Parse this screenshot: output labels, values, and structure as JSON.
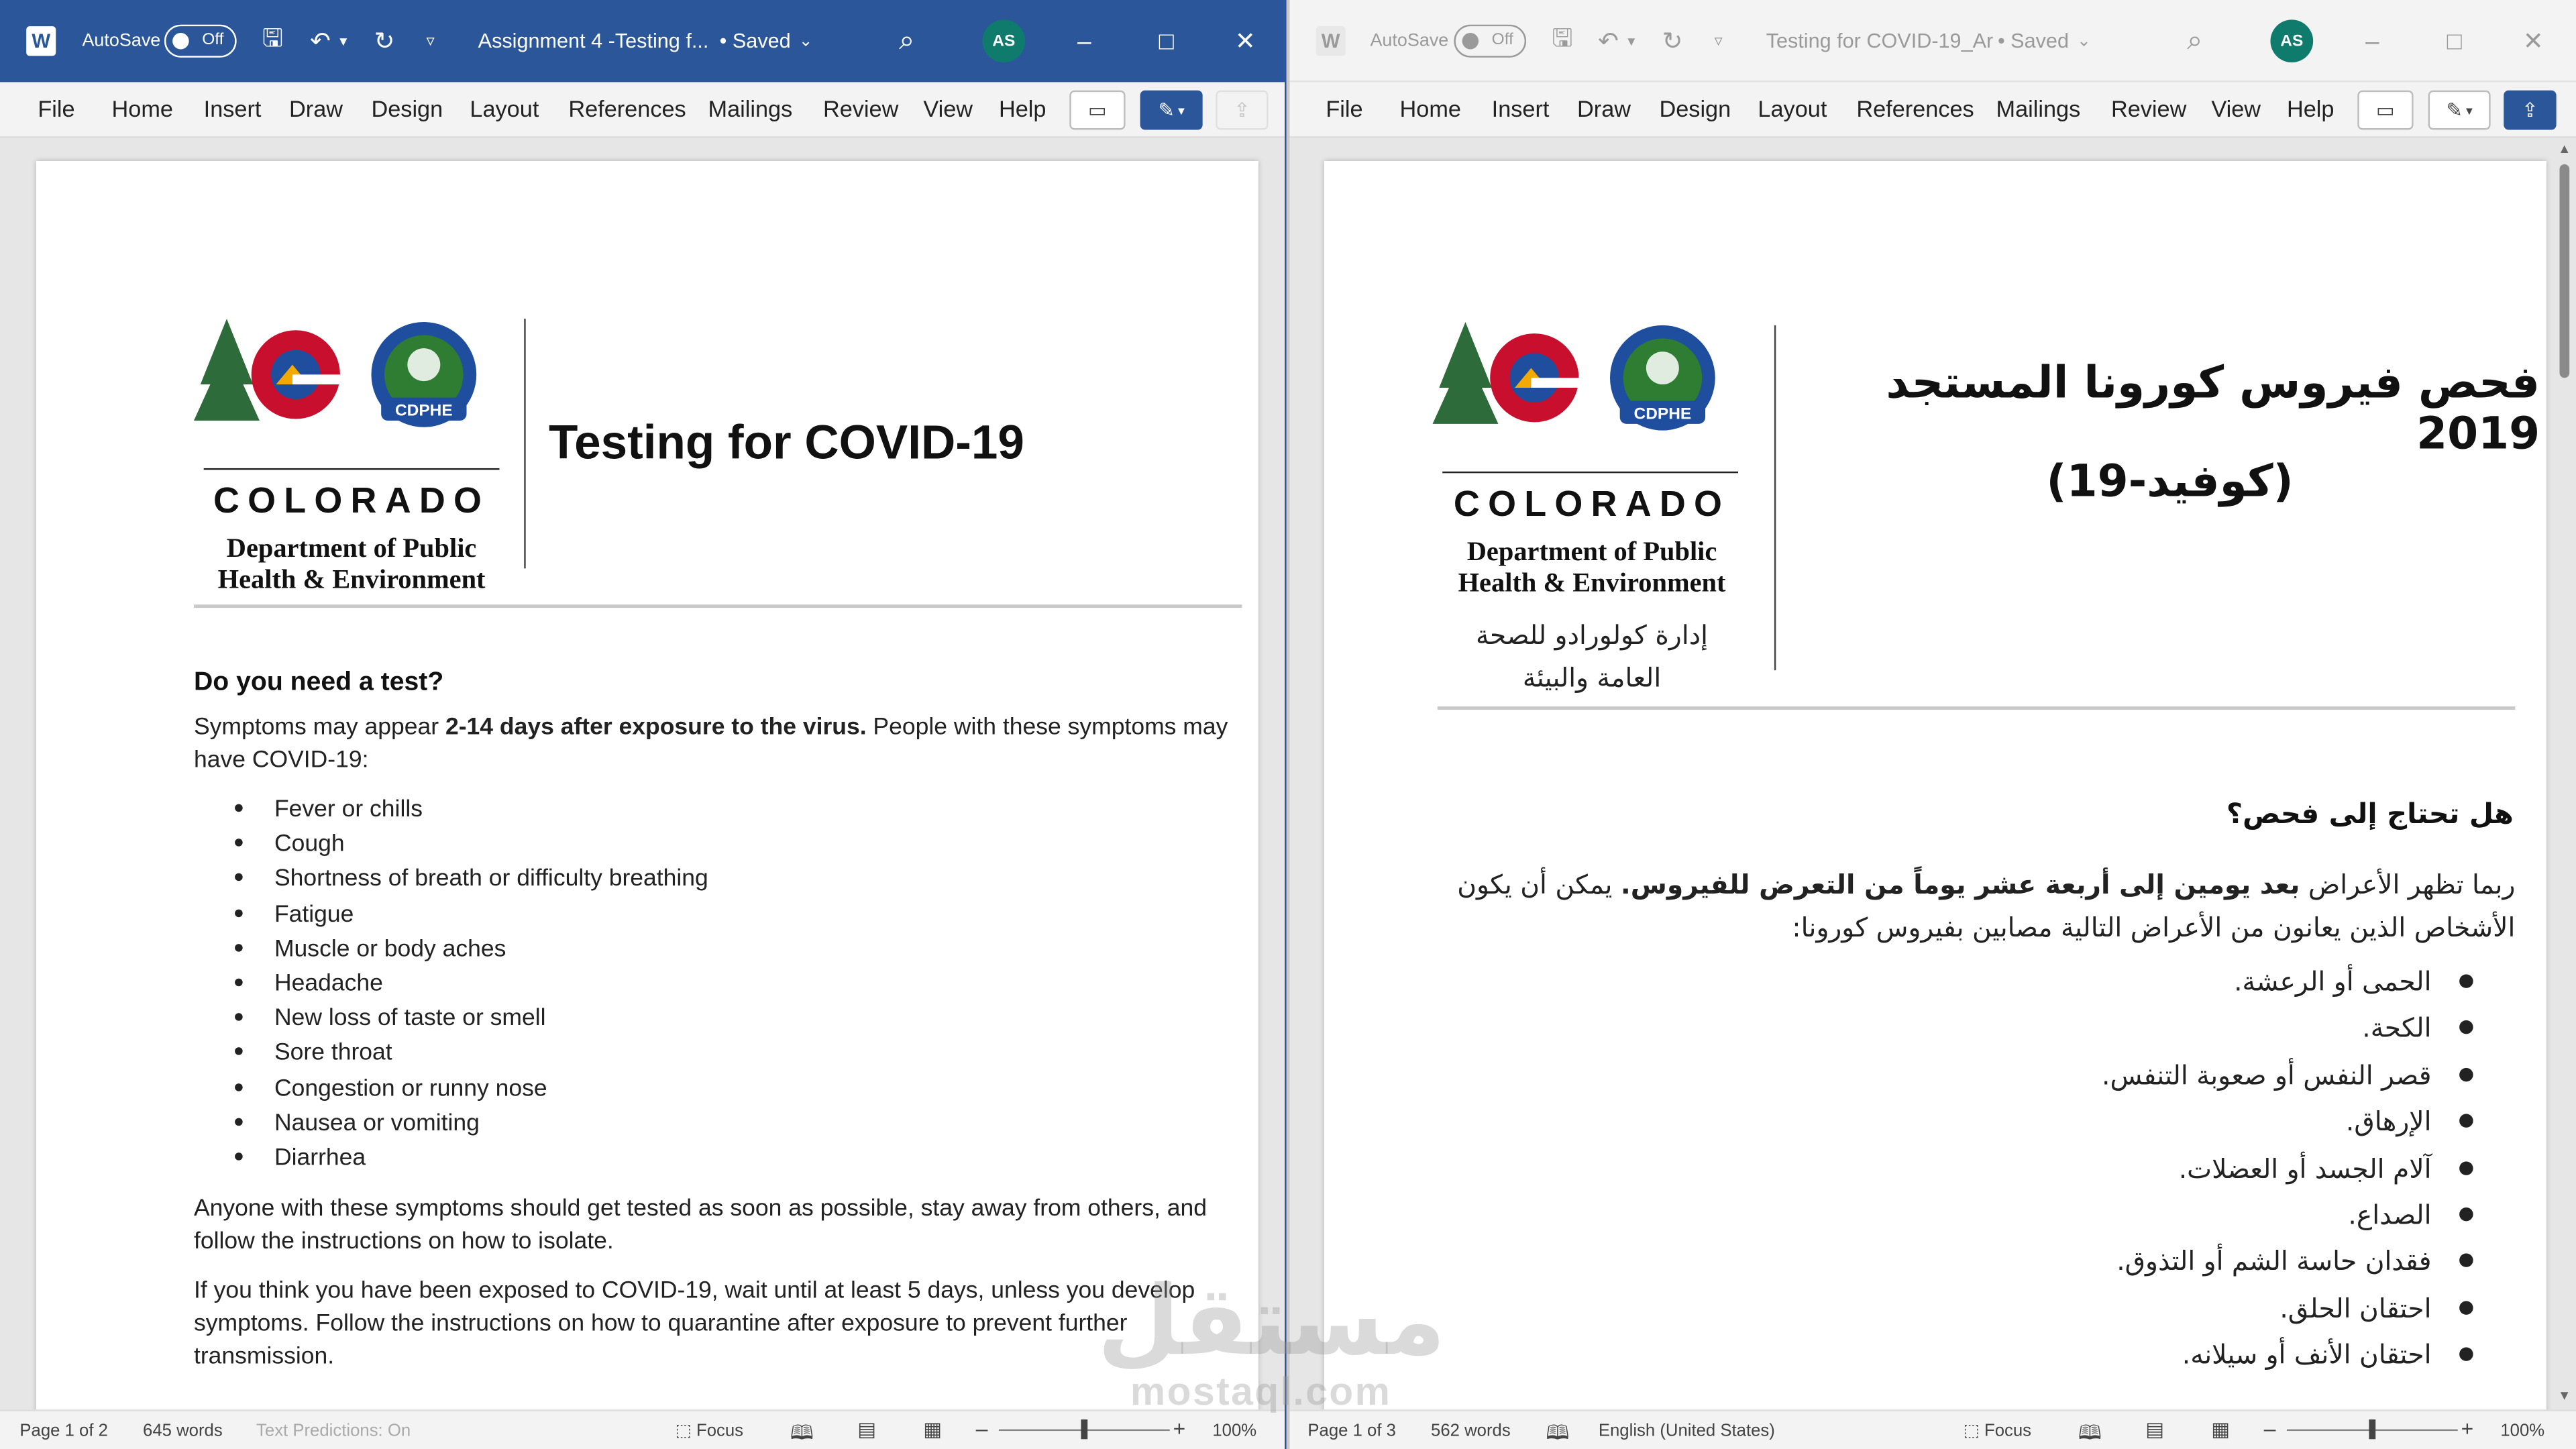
{
  "left": {
    "titlebar": {
      "app_icon": "W",
      "autosave_label": "AutoSave",
      "autosave_state": "Off",
      "doc_title": "Assignment 4 -Testing f...",
      "saved": "• Saved",
      "avatar": "AS"
    },
    "menu": [
      "File",
      "Home",
      "Insert",
      "Draw",
      "Design",
      "Layout",
      "References",
      "Mailings",
      "Review",
      "View",
      "Help"
    ],
    "logo": {
      "wordmark": "COLORADO",
      "badge": "CDPHE",
      "dept_line1": "Department of Public",
      "dept_line2": "Health & Environment"
    },
    "heading": "Testing for COVID-19",
    "section_heading": "Do you need a test?",
    "intro_before": "Symptoms may appear ",
    "intro_bold": "2-14 days after exposure to the virus.",
    "intro_after": " People with these symptoms may have COVID-19:",
    "symptoms": [
      "Fever or chills",
      "Cough",
      "Shortness of breath or difficulty breathing",
      "Fatigue",
      "Muscle or body aches",
      "Headache",
      "New loss of taste or smell",
      "Sore throat",
      "Congestion or runny nose",
      "Nausea or vomiting",
      "Diarrhea"
    ],
    "para2": "Anyone with these symptoms should get tested as soon as possible, stay away from others, and follow the instructions on how to isolate.",
    "para3": "If you think you have been exposed to COVID-19, wait until at least 5 days, unless you develop symptoms. Follow the instructions on how to quarantine after exposure to prevent further transmission.",
    "status": {
      "page": "Page 1 of 2",
      "words": "645 words",
      "predictions": "Text Predictions: On",
      "focus": "Focus",
      "zoom": "100%"
    }
  },
  "right": {
    "titlebar": {
      "app_icon": "W",
      "autosave_label": "AutoSave",
      "autosave_state": "Off",
      "doc_title": "Testing for COVID-19_Ar",
      "saved": "• Saved",
      "avatar": "AS"
    },
    "menu": [
      "File",
      "Home",
      "Insert",
      "Draw",
      "Design",
      "Layout",
      "References",
      "Mailings",
      "Review",
      "View",
      "Help"
    ],
    "logo": {
      "wordmark": "COLORADO",
      "badge": "CDPHE",
      "dept_line1": "Department of Public",
      "dept_line2": "Health & Environment",
      "arabic_line1": "إدارة كولورادو للصحة",
      "arabic_line2": "العامة والبيئة"
    },
    "heading_line1": "فحص فيروس كورونا المستجد 2019",
    "heading_line2": "(كوفيد-19)",
    "section_heading": "هل تحتاج إلى فحص؟",
    "intro_before": "ربما تظهر الأعراض ",
    "intro_bold": "بعد يومين إلى أربعة عشر يوماً من التعرض للفيروس.",
    "intro_after": " يمكن أن يكون الأشخاص الذين يعانون من الأعراض التالية مصابين بفيروس كورونا:",
    "symptoms": [
      "الحمى أو الرعشة.",
      "الكحة.",
      "قصر النفس أو صعوبة التنفس.",
      "الإرهاق.",
      "آلام الجسد أو العضلات.",
      "الصداع.",
      "فقدان حاسة الشم أو التذوق.",
      "احتقان الحلق.",
      "احتقان الأنف أو سيلانه."
    ],
    "status": {
      "page": "Page 1 of 3",
      "words": "562 words",
      "language": "English (United States)",
      "focus": "Focus",
      "zoom": "100%"
    }
  },
  "watermark": {
    "arabic": "مستقل",
    "latin": "mostaql.com"
  },
  "colors": {
    "word_blue": "#2b579a",
    "avatar_teal": "#0f7b6c",
    "logo_red": "#c8102e",
    "logo_blue": "#1e4e9d",
    "logo_green": "#2e7d32",
    "logo_gold": "#f2a900"
  }
}
